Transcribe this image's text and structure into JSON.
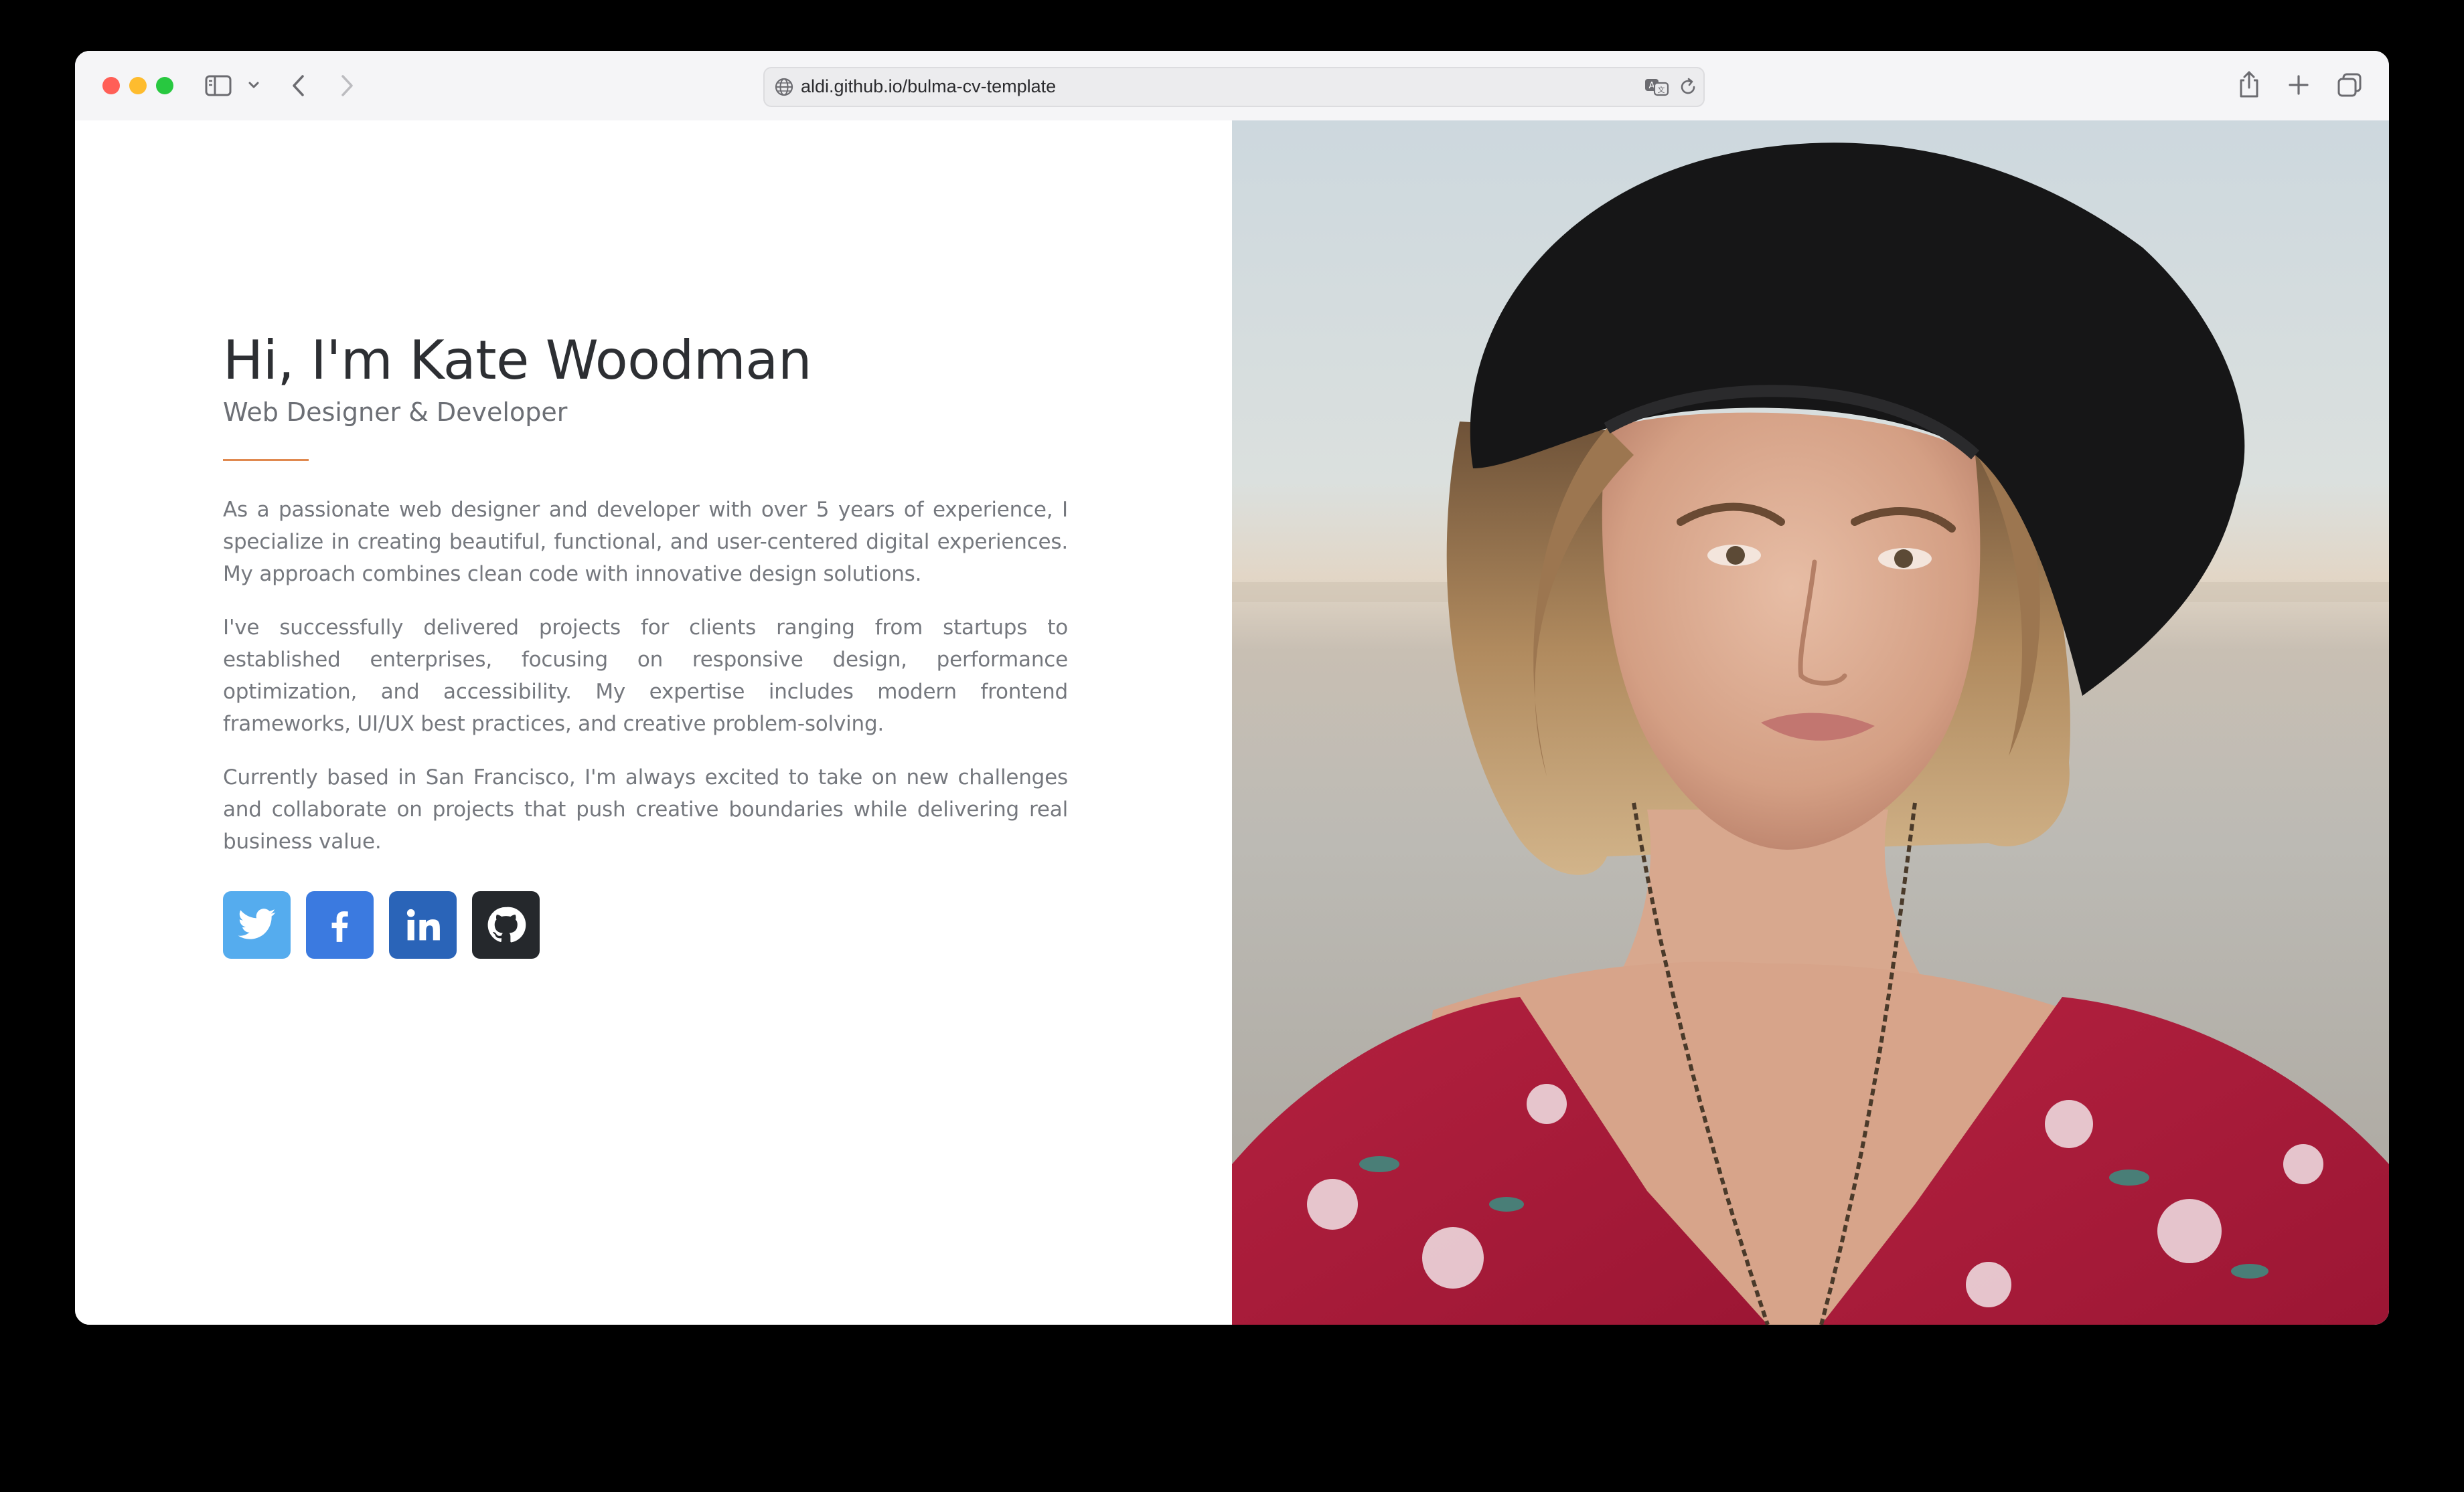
{
  "browser": {
    "url": "aldi.github.io/bulma-cv-template"
  },
  "hero": {
    "title": "Hi, I'm Kate Woodman",
    "subtitle": "Web Designer & Developer",
    "accent_color": "#e0894f"
  },
  "bio": {
    "paragraphs": [
      "As a passionate web designer and developer with over 5 years of experience, I specialize in creating beautiful, functional, and user-centered digital experiences. My approach combines clean code with innovative design solutions.",
      "I've successfully delivered projects for clients ranging from startups to established enterprises, focusing on responsive design, performance optimization, and accessibility. My expertise includes modern frontend frameworks, UI/UX best practices, and creative problem-solving.",
      "Currently based in San Francisco, I'm always excited to take on new challenges and collaborate on projects that push creative boundaries while delivering real business value."
    ]
  },
  "social": [
    {
      "icon": "twitter-icon",
      "color": "#55acee"
    },
    {
      "icon": "facebook-icon",
      "color": "#3b7ae0"
    },
    {
      "icon": "linkedin-icon",
      "color": "#2a64b8"
    },
    {
      "icon": "github-icon",
      "color": "#25282c"
    }
  ]
}
